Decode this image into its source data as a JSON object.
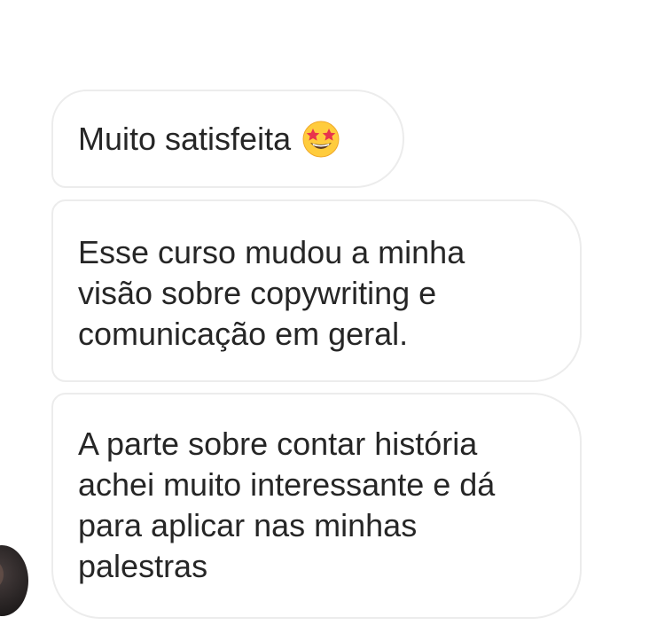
{
  "messages": [
    {
      "text": "Muito satisfeita",
      "emoji": "star-struck-emoji-icon"
    },
    {
      "text": "Esse curso mudou a minha visão sobre copywriting e comunicação em geral."
    },
    {
      "text": "A parte sobre contar história achei muito interessante e dá para aplicar nas minhas palestras"
    }
  ],
  "colors": {
    "bubble_border": "#ececec",
    "text": "#262626",
    "background": "#ffffff"
  }
}
